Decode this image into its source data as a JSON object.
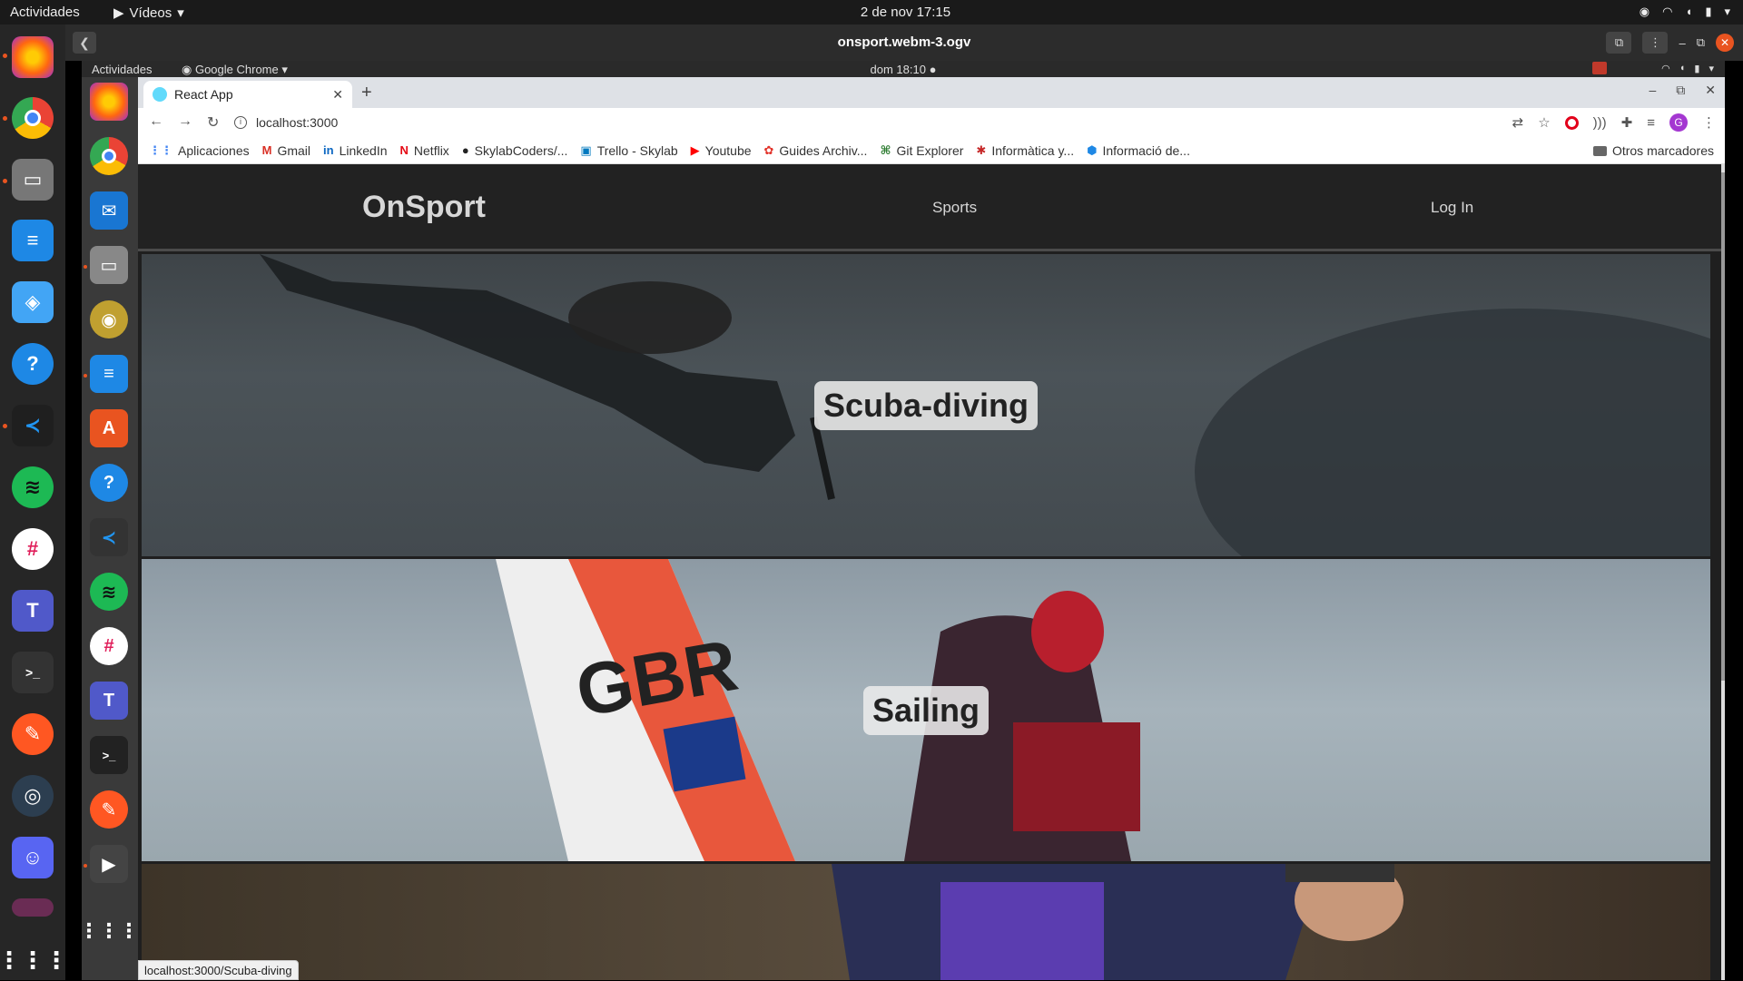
{
  "outer": {
    "activities": "Actividades",
    "app_menu": "Vídeos",
    "clock": "2 de nov  17:15",
    "video_title": "onsport.webm-3.ogv"
  },
  "inner": {
    "activities": "Actividades",
    "app_menu": "Google Chrome",
    "clock": "dom 18:10"
  },
  "browser": {
    "tab_title": "React App",
    "url": "localhost:3000",
    "bookmarks": [
      {
        "label": "Aplicaciones",
        "icon": "apps-grid-icon",
        "color": "#4285f4"
      },
      {
        "label": "Gmail",
        "icon": "gmail-icon",
        "color": "#d93025"
      },
      {
        "label": "LinkedIn",
        "icon": "linkedin-icon",
        "color": "#0a66c2"
      },
      {
        "label": "Netflix",
        "icon": "netflix-icon",
        "color": "#e50914"
      },
      {
        "label": "SkylabCoders/...",
        "icon": "github-icon",
        "color": "#222222"
      },
      {
        "label": "Trello - Skylab",
        "icon": "trello-icon",
        "color": "#0079bf"
      },
      {
        "label": "Youtube",
        "icon": "youtube-icon",
        "color": "#ff0000"
      },
      {
        "label": "Guides Archiv...",
        "icon": "guides-icon",
        "color": "#e2332a"
      },
      {
        "label": "Git Explorer",
        "icon": "git-explorer-icon",
        "color": "#2e7d32"
      },
      {
        "label": "Informàtica y...",
        "icon": "informatica-icon",
        "color": "#c62828"
      },
      {
        "label": "Informació de...",
        "icon": "hexagon-icon",
        "color": "#1e88e5"
      }
    ],
    "other_bookmarks": "Otros marcadores",
    "status_url": "localhost:3000/Scuba-diving"
  },
  "site": {
    "logo": "OnSport",
    "nav_sports": "Sports",
    "nav_login": "Log In",
    "cards": [
      {
        "label": "Scuba-diving"
      },
      {
        "label": "Sailing"
      },
      {
        "label": ""
      }
    ]
  }
}
